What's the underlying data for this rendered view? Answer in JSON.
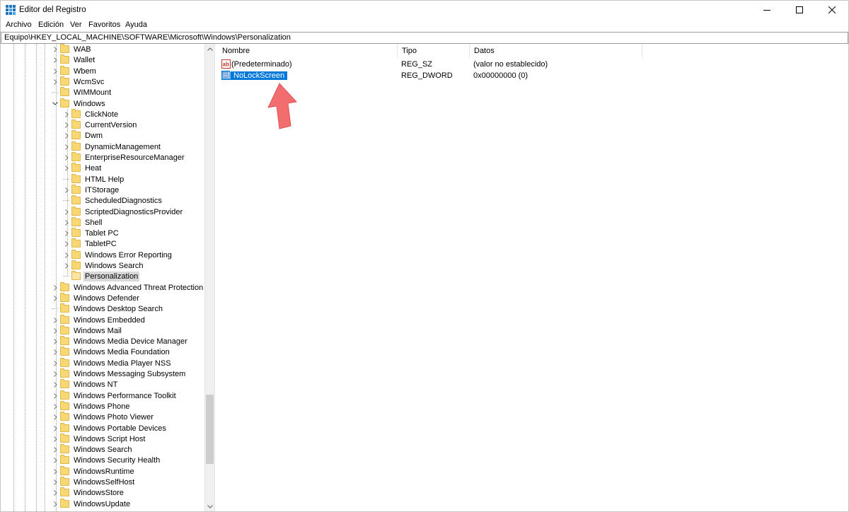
{
  "window": {
    "title": "Editor del Registro",
    "icon": "regedit-icon"
  },
  "menu": [
    "Archivo",
    "Edición",
    "Ver",
    "Favoritos",
    "Ayuda"
  ],
  "address": "Equipo\\HKEY_LOCAL_MACHINE\\SOFTWARE\\Microsoft\\Windows\\Personalization",
  "tree": {
    "top_items": [
      {
        "label": "WAB",
        "expander": "collapsed"
      },
      {
        "label": "Wallet",
        "expander": "collapsed"
      },
      {
        "label": "Wbem",
        "expander": "collapsed"
      },
      {
        "label": "WcmSvc",
        "expander": "collapsed"
      },
      {
        "label": "WIMMount",
        "expander": "none"
      },
      {
        "label": "Windows",
        "expander": "expanded"
      }
    ],
    "windows_children": [
      {
        "label": "ClickNote",
        "expander": "collapsed"
      },
      {
        "label": "CurrentVersion",
        "expander": "collapsed"
      },
      {
        "label": "Dwm",
        "expander": "collapsed"
      },
      {
        "label": "DynamicManagement",
        "expander": "collapsed"
      },
      {
        "label": "EnterpriseResourceManager",
        "expander": "collapsed"
      },
      {
        "label": "Heat",
        "expander": "collapsed"
      },
      {
        "label": "HTML Help",
        "expander": "none"
      },
      {
        "label": "ITStorage",
        "expander": "collapsed"
      },
      {
        "label": "ScheduledDiagnostics",
        "expander": "none"
      },
      {
        "label": "ScriptedDiagnosticsProvider",
        "expander": "collapsed"
      },
      {
        "label": "Shell",
        "expander": "collapsed"
      },
      {
        "label": "Tablet PC",
        "expander": "collapsed"
      },
      {
        "label": "TabletPC",
        "expander": "collapsed"
      },
      {
        "label": "Windows Error Reporting",
        "expander": "collapsed"
      },
      {
        "label": "Windows Search",
        "expander": "collapsed"
      },
      {
        "label": "Personalization",
        "expander": "none",
        "selected": true
      }
    ],
    "bottom_items": [
      {
        "label": "Windows Advanced Threat Protection",
        "expander": "collapsed"
      },
      {
        "label": "Windows Defender",
        "expander": "collapsed"
      },
      {
        "label": "Windows Desktop Search",
        "expander": "none"
      },
      {
        "label": "Windows Embedded",
        "expander": "collapsed"
      },
      {
        "label": "Windows Mail",
        "expander": "collapsed"
      },
      {
        "label": "Windows Media Device Manager",
        "expander": "collapsed"
      },
      {
        "label": "Windows Media Foundation",
        "expander": "collapsed"
      },
      {
        "label": "Windows Media Player NSS",
        "expander": "collapsed"
      },
      {
        "label": "Windows Messaging Subsystem",
        "expander": "collapsed"
      },
      {
        "label": "Windows NT",
        "expander": "collapsed"
      },
      {
        "label": "Windows Performance Toolkit",
        "expander": "collapsed"
      },
      {
        "label": "Windows Phone",
        "expander": "collapsed"
      },
      {
        "label": "Windows Photo Viewer",
        "expander": "collapsed"
      },
      {
        "label": "Windows Portable Devices",
        "expander": "collapsed"
      },
      {
        "label": "Windows Script Host",
        "expander": "collapsed"
      },
      {
        "label": "Windows Search",
        "expander": "collapsed"
      },
      {
        "label": "Windows Security Health",
        "expander": "collapsed"
      },
      {
        "label": "WindowsRuntime",
        "expander": "collapsed"
      },
      {
        "label": "WindowsSelfHost",
        "expander": "collapsed"
      },
      {
        "label": "WindowsStore",
        "expander": "collapsed"
      },
      {
        "label": "WindowsUpdate",
        "expander": "collapsed"
      }
    ]
  },
  "columns": {
    "name": "Nombre",
    "type": "Tipo",
    "data": "Datos"
  },
  "values": [
    {
      "name": "(Predeterminado)",
      "type": "REG_SZ",
      "data": "(valor no establecido)",
      "icon": "string-value-icon"
    },
    {
      "name": "NoLockScreen",
      "type": "REG_DWORD",
      "data": "0x00000000 (0)",
      "icon": "binary-value-icon",
      "selected": true
    }
  ],
  "colors": {
    "selection": "#0078d7",
    "arrow": "#f26d6d",
    "folder": "#f8d775"
  }
}
